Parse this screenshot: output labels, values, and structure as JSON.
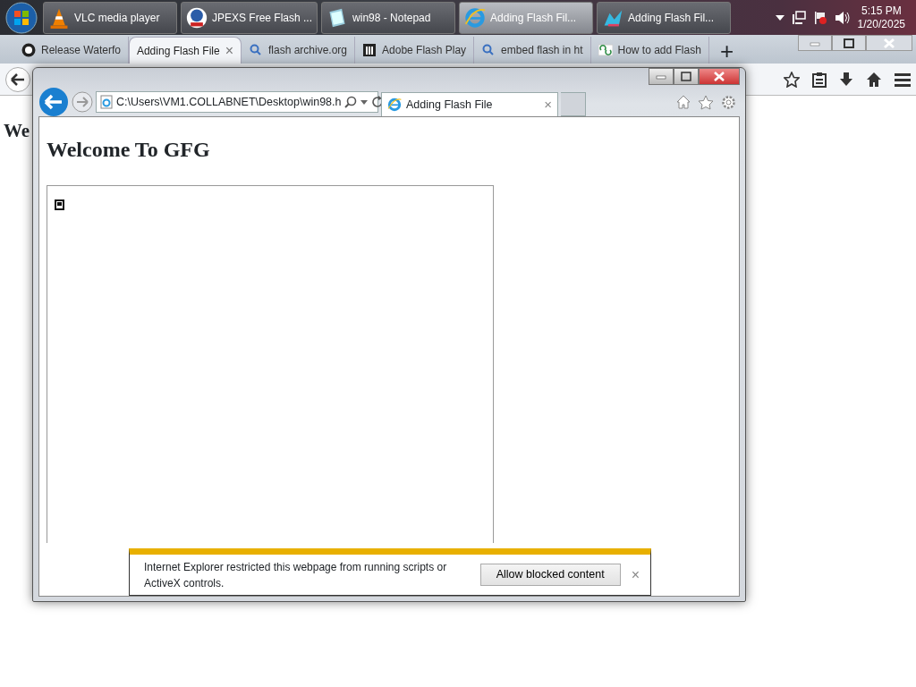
{
  "taskbar": {
    "buttons": [
      {
        "label": "VLC media player",
        "selected": false
      },
      {
        "label": "JPEXS Free Flash ...",
        "selected": false
      },
      {
        "label": "win98 - Notepad",
        "selected": false
      },
      {
        "label": "Adding Flash Fil...",
        "selected": true
      },
      {
        "label": "Adding Flash Fil...",
        "selected": false
      }
    ],
    "clock": {
      "time": "5:15 PM",
      "date": "1/20/2025"
    }
  },
  "firefox": {
    "tabs": [
      {
        "label": "Release Waterfo",
        "selected": false
      },
      {
        "label": "Adding Flash File",
        "selected": true,
        "close": "×"
      },
      {
        "label": "flash archive.org",
        "selected": false
      },
      {
        "label": "Adobe Flash Play",
        "selected": false
      },
      {
        "label": "embed flash in ht",
        "selected": false
      },
      {
        "label": "How to add Flash",
        "selected": false
      }
    ],
    "new_tab": "+",
    "page_heading": "We"
  },
  "ie": {
    "address": "C:\\Users\\VM1.COLLABNET\\Desktop\\win98.h",
    "tab": {
      "label": "Adding Flash File",
      "close": "×"
    },
    "heading": "Welcome To GFG",
    "notification": {
      "message": "Internet Explorer restricted this webpage from running scripts or ActiveX controls.",
      "button": "Allow blocked content",
      "close": "×"
    }
  }
}
